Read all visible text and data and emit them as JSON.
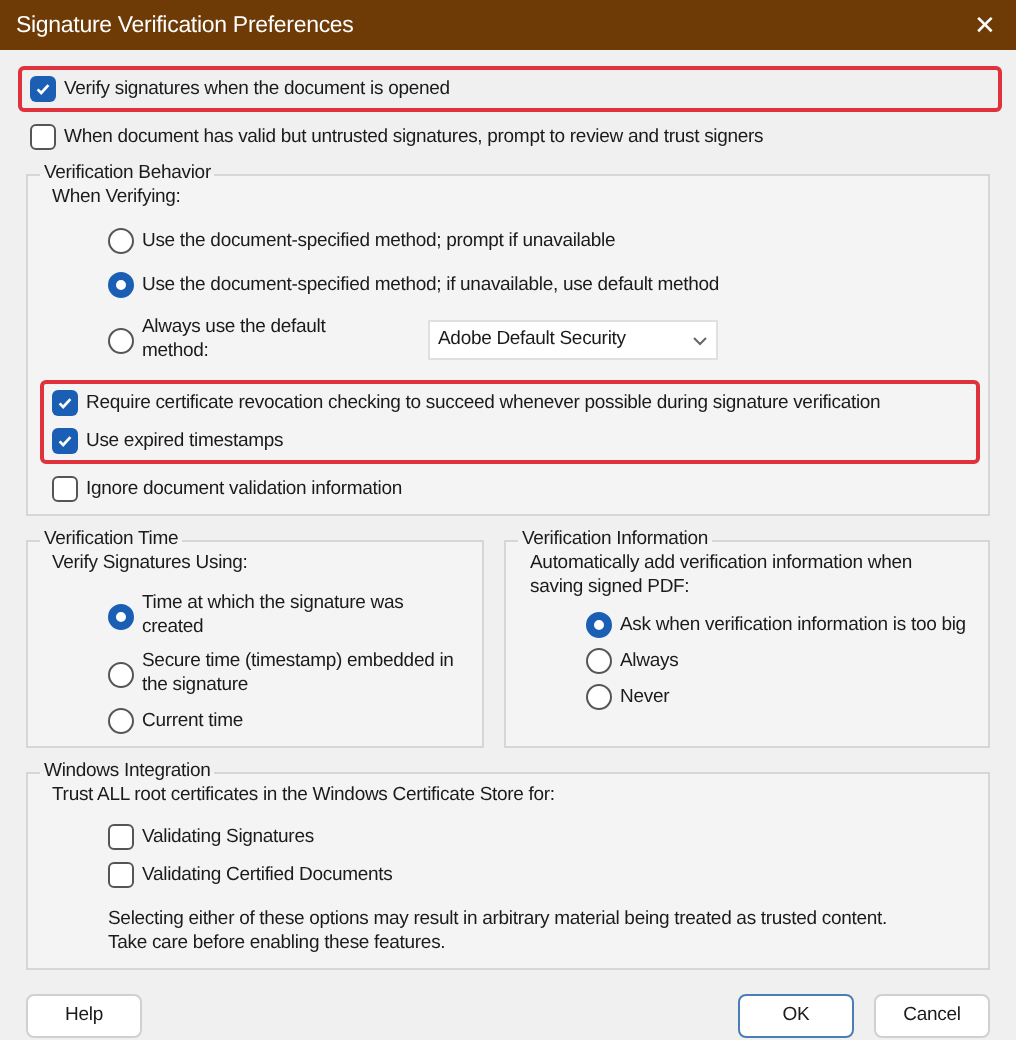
{
  "window": {
    "title": "Signature Verification Preferences",
    "close": "✕"
  },
  "top_options": [
    {
      "label": "Verify signatures when the document is opened",
      "checked": true,
      "highlighted": true
    },
    {
      "label": "When document has valid but untrusted signatures, prompt to review and trust signers",
      "checked": false,
      "highlighted": false
    }
  ],
  "verification_behavior": {
    "title": "Verification Behavior",
    "subtitle": "When Verifying:",
    "methods": [
      {
        "label": "Use the document-specified method; prompt if unavailable",
        "selected": false
      },
      {
        "label": "Use the document-specified method; if unavailable, use default method",
        "selected": true
      },
      {
        "label": "Always use the default method:",
        "selected": false
      }
    ],
    "default_method": {
      "value": "Adobe Default Security"
    },
    "options": [
      {
        "label": "Require certificate revocation checking to succeed whenever possible during signature verification",
        "checked": true,
        "highlighted": true
      },
      {
        "label": "Use expired timestamps",
        "checked": true,
        "highlighted": true
      },
      {
        "label": "Ignore document validation information",
        "checked": false,
        "highlighted": false
      }
    ]
  },
  "verification_time": {
    "title": "Verification Time",
    "subtitle": "Verify Signatures Using:",
    "choices": [
      {
        "label": "Time at which the signature was created",
        "selected": true
      },
      {
        "label": "Secure time (timestamp) embedded in the signature",
        "selected": false
      },
      {
        "label": "Current time",
        "selected": false
      }
    ]
  },
  "verification_information": {
    "title": "Verification Information",
    "subtitle": "Automatically add verification information when saving signed PDF:",
    "choices": [
      {
        "label": "Ask when verification information is too big",
        "selected": true
      },
      {
        "label": "Always",
        "selected": false
      },
      {
        "label": "Never",
        "selected": false
      }
    ]
  },
  "windows_integration": {
    "title": "Windows Integration",
    "subtitle": "Trust ALL root certificates in the Windows Certificate Store for:",
    "options": [
      {
        "label": "Validating Signatures",
        "checked": false
      },
      {
        "label": "Validating Certified Documents",
        "checked": false
      }
    ],
    "note": "Selecting either of these options may result in arbitrary material being treated as trusted content. Take care before enabling these features."
  },
  "buttons": [
    {
      "label": "Help",
      "kind": "secondary"
    },
    {
      "label": "OK",
      "kind": "default"
    },
    {
      "label": "Cancel",
      "kind": "secondary"
    }
  ]
}
